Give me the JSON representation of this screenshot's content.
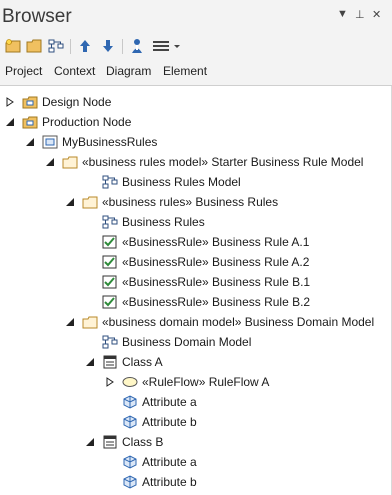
{
  "window": {
    "title": "Browser",
    "controls": {
      "dropdown": "▼",
      "pin": "⊥",
      "close": "✕"
    }
  },
  "toolbar": {
    "icons": [
      "new-package-icon",
      "folder-icon",
      "diagram-icon",
      "move-up-icon",
      "move-down-icon",
      "properties-icon",
      "menu-icon"
    ]
  },
  "tabs": [
    {
      "label": "Project",
      "active": true
    },
    {
      "label": "Context",
      "active": false
    },
    {
      "label": "Diagram",
      "active": false
    },
    {
      "label": "Element",
      "active": false
    }
  ],
  "tree": [
    {
      "label": "Design Node",
      "icon": "package-root",
      "toggle": "collapsed"
    },
    {
      "label": "Production Node",
      "icon": "package-root",
      "toggle": "expanded"
    },
    {
      "label": "MyBusinessRules",
      "icon": "model",
      "toggle": "expanded"
    },
    {
      "label": "«business rules model» Starter Business Rule Model",
      "icon": "folder",
      "toggle": "expanded"
    },
    {
      "label": "Business Rules Model",
      "icon": "diagram",
      "toggle": "none"
    },
    {
      "label": "«business rules» Business Rules",
      "icon": "folder",
      "toggle": "expanded"
    },
    {
      "label": "Business Rules",
      "icon": "diagram",
      "toggle": "none"
    },
    {
      "label": "«BusinessRule» Business Rule A.1",
      "icon": "rule",
      "toggle": "none"
    },
    {
      "label": "«BusinessRule» Business Rule A.2",
      "icon": "rule",
      "toggle": "none"
    },
    {
      "label": "«BusinessRule» Business Rule B.1",
      "icon": "rule",
      "toggle": "none"
    },
    {
      "label": "«BusinessRule» Business Rule B.2",
      "icon": "rule",
      "toggle": "none"
    },
    {
      "label": "«business domain model» Business Domain Model",
      "icon": "folder",
      "toggle": "expanded"
    },
    {
      "label": "Business Domain Model",
      "icon": "diagram",
      "toggle": "none"
    },
    {
      "label": "Class A",
      "icon": "class",
      "toggle": "expanded"
    },
    {
      "label": "«RuleFlow» RuleFlow A",
      "icon": "activity",
      "toggle": "collapsed"
    },
    {
      "label": "Attribute a",
      "icon": "attribute",
      "toggle": "none"
    },
    {
      "label": "Attribute b",
      "icon": "attribute",
      "toggle": "none"
    },
    {
      "label": "Class B",
      "icon": "class",
      "toggle": "expanded"
    },
    {
      "label": "Attribute a",
      "icon": "attribute",
      "toggle": "none"
    },
    {
      "label": "Attribute b",
      "icon": "attribute",
      "toggle": "none"
    }
  ],
  "colors": {
    "panel_bg": "#f3f3f3",
    "active_tab": "#1f5fa8",
    "folder": "#e8b85a",
    "icon_blue": "#2f67b1",
    "rule_green": "#2e8b3a"
  }
}
